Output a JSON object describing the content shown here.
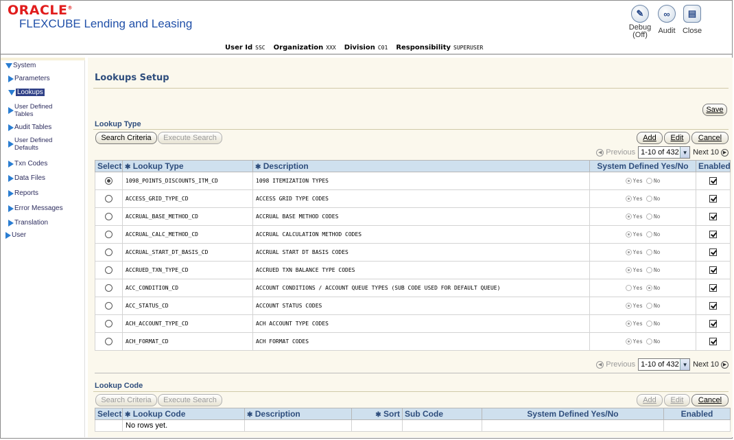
{
  "header": {
    "brand": "ORACLE",
    "brand_mark": "®",
    "product": "FLEXCUBE Lending and Leasing",
    "user_id_label": "User Id",
    "user_id": "SSC",
    "org_label": "Organization",
    "org": "XXX",
    "division_label": "Division",
    "division": "C01",
    "resp_label": "Responsibility",
    "resp": "SUPERUSER",
    "debug_label": "Debug",
    "debug_state": "(Off)",
    "audit_label": "Audit",
    "close_label": "Close"
  },
  "sidebar": {
    "system": "System",
    "parameters": "Parameters",
    "lookups": "Lookups",
    "udt_1": "User Defined",
    "udt_2": "Tables",
    "audit_tables": "Audit Tables",
    "udd_1": "User Defined",
    "udd_2": "Defaults",
    "txn_codes": "Txn Codes",
    "data_files": "Data Files",
    "reports": "Reports",
    "error_messages": "Error Messages",
    "translation": "Translation",
    "user": "User"
  },
  "page": {
    "title": "Lookups Setup",
    "save": "Save"
  },
  "lookup_type": {
    "title": "Lookup Type",
    "search_criteria": "Search Criteria",
    "execute_search": "Execute Search",
    "add": "Add",
    "edit": "Edit",
    "cancel": "Cancel",
    "previous": "Previous",
    "range": "1-10 of 432",
    "next": "Next 10",
    "columns": {
      "select": "Select",
      "type": "Lookup Type",
      "description": "Description",
      "system_defined": "System Defined Yes/No",
      "enabled": "Enabled"
    },
    "yes": "Yes",
    "no": "No",
    "rows": [
      {
        "type": "1098_POINTS_DISCOUNTS_ITM_CD",
        "description": "1098 ITEMIZATION TYPES",
        "system_defined": "Yes",
        "enabled": true,
        "selected": true
      },
      {
        "type": "ACCESS_GRID_TYPE_CD",
        "description": "ACCESS GRID TYPE CODES",
        "system_defined": "Yes",
        "enabled": true,
        "selected": false
      },
      {
        "type": "ACCRUAL_BASE_METHOD_CD",
        "description": "ACCRUAL BASE METHOD CODES",
        "system_defined": "Yes",
        "enabled": true,
        "selected": false
      },
      {
        "type": "ACCRUAL_CALC_METHOD_CD",
        "description": "ACCRUAL CALCULATION METHOD CODES",
        "system_defined": "Yes",
        "enabled": true,
        "selected": false
      },
      {
        "type": "ACCRUAL_START_DT_BASIS_CD",
        "description": "ACCRUAL START DT BASIS CODES",
        "system_defined": "Yes",
        "enabled": true,
        "selected": false
      },
      {
        "type": "ACCRUED_TXN_TYPE_CD",
        "description": "ACCRUED TXN BALANCE TYPE CODES",
        "system_defined": "Yes",
        "enabled": true,
        "selected": false
      },
      {
        "type": "ACC_CONDITION_CD",
        "description": "ACCOUNT CONDITIONS / ACCOUNT QUEUE TYPES (SUB CODE USED FOR DEFAULT QUEUE)",
        "system_defined": "No",
        "enabled": true,
        "selected": false
      },
      {
        "type": "ACC_STATUS_CD",
        "description": "ACCOUNT STATUS CODES",
        "system_defined": "Yes",
        "enabled": true,
        "selected": false
      },
      {
        "type": "ACH_ACCOUNT_TYPE_CD",
        "description": "ACH ACCOUNT TYPE CODES",
        "system_defined": "Yes",
        "enabled": true,
        "selected": false
      },
      {
        "type": "ACH_FORMAT_CD",
        "description": "ACH FORMAT CODES",
        "system_defined": "Yes",
        "enabled": true,
        "selected": false
      }
    ]
  },
  "lookup_code": {
    "title": "Lookup Code",
    "search_criteria": "Search Criteria",
    "execute_search": "Execute Search",
    "add": "Add",
    "edit": "Edit",
    "cancel": "Cancel",
    "columns": {
      "select": "Select",
      "code": "Lookup Code",
      "description": "Description",
      "sort": "Sort",
      "sub_code": "Sub Code",
      "system_defined": "System Defined Yes/No",
      "enabled": "Enabled"
    },
    "empty": "No rows yet."
  }
}
